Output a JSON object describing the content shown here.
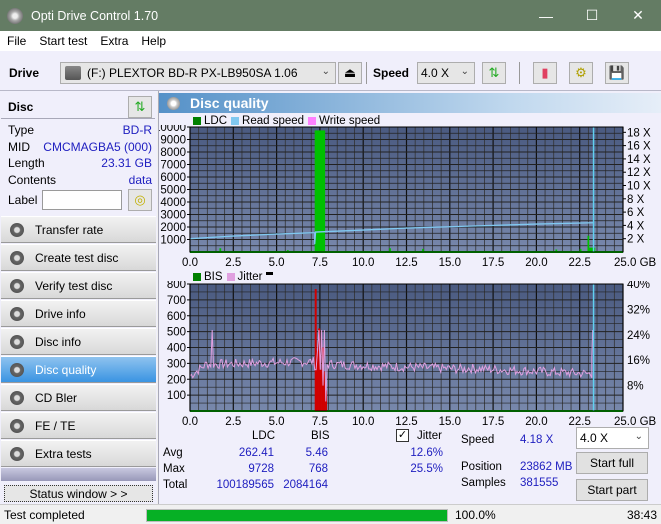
{
  "window": {
    "title": "Opti Drive Control 1.70",
    "minimize": "—",
    "maximize": "☐",
    "close": "✕"
  },
  "menu": [
    "File",
    "Start test",
    "Extra",
    "Help"
  ],
  "toolbar": {
    "drive_label": "Drive",
    "drive_value": "(F:)  PLEXTOR BD-R  PX-LB950SA 1.06",
    "speed_label": "Speed",
    "speed_value": "4.0 X",
    "icons": [
      "eject-icon",
      "refresh-icon",
      "erase-icon",
      "settings-icon",
      "save-icon"
    ]
  },
  "disc": {
    "header": "Disc",
    "rows": [
      {
        "label": "Type",
        "value": "BD-R"
      },
      {
        "label": "MID",
        "value": "CMCMAGBA5 (000)"
      },
      {
        "label": "Length",
        "value": "23.31 GB"
      },
      {
        "label": "Contents",
        "value": "data"
      }
    ],
    "label_label": "Label",
    "label_value": ""
  },
  "nav": [
    {
      "label": "Transfer rate",
      "active": false
    },
    {
      "label": "Create test disc",
      "active": false
    },
    {
      "label": "Verify test disc",
      "active": false
    },
    {
      "label": "Drive info",
      "active": false
    },
    {
      "label": "Disc info",
      "active": false
    },
    {
      "label": "Disc quality",
      "active": true
    },
    {
      "label": "CD Bler",
      "active": false
    },
    {
      "label": "FE / TE",
      "active": false
    },
    {
      "label": "Extra tests",
      "active": false
    }
  ],
  "status_window_label": "Status window > >",
  "panel": {
    "title": "Disc quality"
  },
  "chart_data": [
    {
      "type": "bar",
      "title": "LDC",
      "legend": [
        {
          "name": "LDC",
          "color": "#008000"
        },
        {
          "name": "Read speed",
          "color": "#80c8f0"
        },
        {
          "name": "Write speed",
          "color": "#ff80ff"
        }
      ],
      "x_ticks": [
        "0.0",
        "2.5",
        "5.0",
        "7.5",
        "10.0",
        "12.5",
        "15.0",
        "17.5",
        "20.0",
        "22.5",
        "25.0 GB"
      ],
      "xlim": [
        0,
        25
      ],
      "y_ticks": [
        "10000",
        "9000",
        "8000",
        "7000",
        "6000",
        "5000",
        "4000",
        "3000",
        "2000",
        "1000"
      ],
      "ylim": [
        0,
        10000
      ],
      "y2_ticks": [
        "18 X",
        "16 X",
        "14 X",
        "12 X",
        "10 X",
        "8 X",
        "6 X",
        "4 X",
        "2 X"
      ],
      "y2lim": [
        0,
        18.8
      ],
      "ldc_spikes": [
        {
          "x": 7.2,
          "w": 0.6,
          "y": 9728
        },
        {
          "x": 1.7,
          "w": 0.1,
          "y": 300
        },
        {
          "x": 5.6,
          "w": 0.1,
          "y": 150
        },
        {
          "x": 11.5,
          "w": 0.1,
          "y": 300
        },
        {
          "x": 13.4,
          "w": 0.1,
          "y": 250
        },
        {
          "x": 21.1,
          "w": 0.1,
          "y": 200
        },
        {
          "x": 22.5,
          "w": 0.1,
          "y": 250
        },
        {
          "x": 23.0,
          "w": 0.4,
          "y": 350
        },
        {
          "x": 22.95,
          "w": 0.1,
          "y": 1300
        }
      ],
      "read_speed": [
        [
          0,
          2.0
        ],
        [
          2.5,
          2.4
        ],
        [
          5,
          2.7
        ],
        [
          7.2,
          2.9
        ],
        [
          7.2,
          1.2
        ],
        [
          7.25,
          3.0
        ],
        [
          10,
          3.3
        ],
        [
          12.5,
          3.6
        ],
        [
          15,
          3.8
        ],
        [
          17.5,
          4.0
        ],
        [
          20,
          4.2
        ],
        [
          23.3,
          4.4
        ]
      ],
      "position_marker": 23.3
    },
    {
      "type": "line",
      "title": "BIS / Jitter",
      "legend": [
        {
          "name": "BIS",
          "color": "#008000"
        },
        {
          "name": "Jitter",
          "color": "#e0a0e0"
        }
      ],
      "x_ticks": [
        "0.0",
        "2.5",
        "5.0",
        "7.5",
        "10.0",
        "12.5",
        "15.0",
        "17.5",
        "20.0",
        "22.5",
        "25.0 GB"
      ],
      "xlim": [
        0,
        25
      ],
      "y_ticks": [
        "800",
        "700",
        "600",
        "500",
        "400",
        "300",
        "200",
        "100"
      ],
      "ylim": [
        0,
        800
      ],
      "y2_ticks": [
        "40%",
        "32%",
        "24%",
        "16%",
        "8%"
      ],
      "y2lim": [
        0,
        40
      ],
      "bis_spikes": [
        {
          "x": 7.2,
          "y": 768
        },
        {
          "x": 7.3,
          "y": 380
        },
        {
          "x": 7.4,
          "y": 520
        },
        {
          "x": 7.5,
          "y": 260
        },
        {
          "x": 7.6,
          "y": 400
        },
        {
          "x": 7.7,
          "y": 250
        },
        {
          "x": 7.8,
          "y": 130
        }
      ],
      "jitter_avg_pct": 12.6,
      "jitter_max_pct": 25.5,
      "position_marker": 23.3
    }
  ],
  "stats": {
    "col_ldc": "LDC",
    "col_bis": "BIS",
    "rows": [
      {
        "label": "Avg",
        "ldc": "262.41",
        "bis": "5.46",
        "jitter": "12.6%"
      },
      {
        "label": "Max",
        "ldc": "9728",
        "bis": "768",
        "jitter": "25.5%"
      },
      {
        "label": "Total",
        "ldc": "100189565",
        "bis": "2084164"
      }
    ],
    "jitter_label": "Jitter",
    "jitter_checked": true,
    "speed_label": "Speed",
    "speed_value": "4.18 X",
    "position_label": "Position",
    "position_value": "23862 MB",
    "samples_label": "Samples",
    "samples_value": "381555",
    "speed_select": "4.0 X",
    "start_full": "Start full",
    "start_part": "Start part"
  },
  "statusbar": {
    "text": "Test completed",
    "progress_pct": 100.0,
    "progress_label": "100.0%",
    "time": "38:43"
  }
}
